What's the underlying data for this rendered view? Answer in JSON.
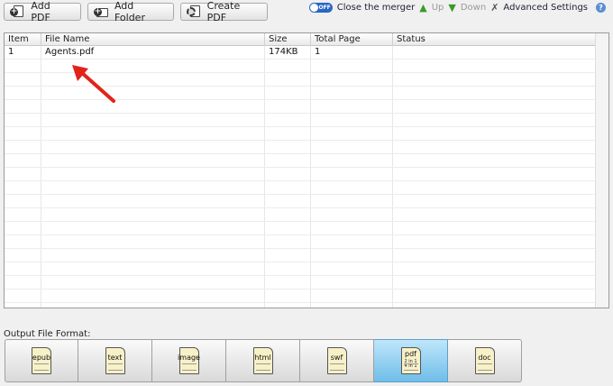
{
  "toolbar": {
    "add_pdf": "Add PDF",
    "add_folder": "Add Folder",
    "create_pdf": "Create PDF"
  },
  "right_tools": {
    "toggle_text": "OFF",
    "close_merger": "Close the merger",
    "up": "Up",
    "down": "Down",
    "advanced": "Advanced Settings"
  },
  "table": {
    "columns": [
      "Item",
      "File Name",
      "Size",
      "Total Page",
      "Status"
    ],
    "rows": [
      {
        "item": "1",
        "file_name": "Agents.pdf",
        "size": "174KB",
        "total_page": "1",
        "status": ""
      }
    ]
  },
  "output": {
    "label": "Output File Format:",
    "formats": [
      {
        "label": "epub",
        "selected": false
      },
      {
        "label": "text",
        "selected": false
      },
      {
        "label": "image",
        "selected": false
      },
      {
        "label": "html",
        "selected": false
      },
      {
        "label": "swf",
        "selected": false
      },
      {
        "label": "pdf",
        "sub1": "2 in 1",
        "sub2": "4 in 1",
        "selected": true
      },
      {
        "label": "doc",
        "selected": false
      }
    ]
  },
  "colors": {
    "annotation_arrow": "#e2231a",
    "selected_format": "#6fbde8"
  }
}
